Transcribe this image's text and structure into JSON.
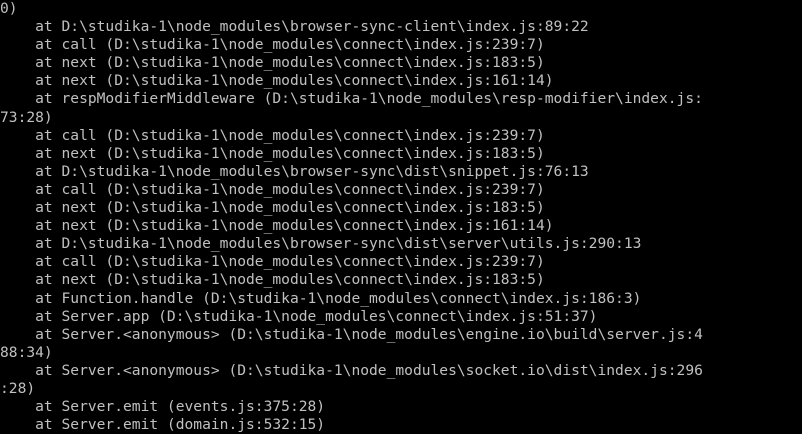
{
  "console": {
    "text_color": "#c0c0c0",
    "background_color": "#000000",
    "lines": [
      "0)",
      "    at D:\\studika-1\\node_modules\\browser-sync-client\\index.js:89:22",
      "    at call (D:\\studika-1\\node_modules\\connect\\index.js:239:7)",
      "    at next (D:\\studika-1\\node_modules\\connect\\index.js:183:5)",
      "    at next (D:\\studika-1\\node_modules\\connect\\index.js:161:14)",
      "    at respModifierMiddleware (D:\\studika-1\\node_modules\\resp-modifier\\index.js:",
      "73:28)",
      "    at call (D:\\studika-1\\node_modules\\connect\\index.js:239:7)",
      "    at next (D:\\studika-1\\node_modules\\connect\\index.js:183:5)",
      "    at D:\\studika-1\\node_modules\\browser-sync\\dist\\snippet.js:76:13",
      "    at call (D:\\studika-1\\node_modules\\connect\\index.js:239:7)",
      "    at next (D:\\studika-1\\node_modules\\connect\\index.js:183:5)",
      "    at next (D:\\studika-1\\node_modules\\connect\\index.js:161:14)",
      "    at D:\\studika-1\\node_modules\\browser-sync\\dist\\server\\utils.js:290:13",
      "    at call (D:\\studika-1\\node_modules\\connect\\index.js:239:7)",
      "    at next (D:\\studika-1\\node_modules\\connect\\index.js:183:5)",
      "    at Function.handle (D:\\studika-1\\node_modules\\connect\\index.js:186:3)",
      "    at Server.app (D:\\studika-1\\node_modules\\connect\\index.js:51:37)",
      "    at Server.<anonymous> (D:\\studika-1\\node_modules\\engine.io\\build\\server.js:4",
      "88:34)",
      "    at Server.<anonymous> (D:\\studika-1\\node_modules\\socket.io\\dist\\index.js:296",
      ":28)",
      "    at Server.emit (events.js:375:28)",
      "    at Server.emit (domain.js:532:15)"
    ]
  }
}
